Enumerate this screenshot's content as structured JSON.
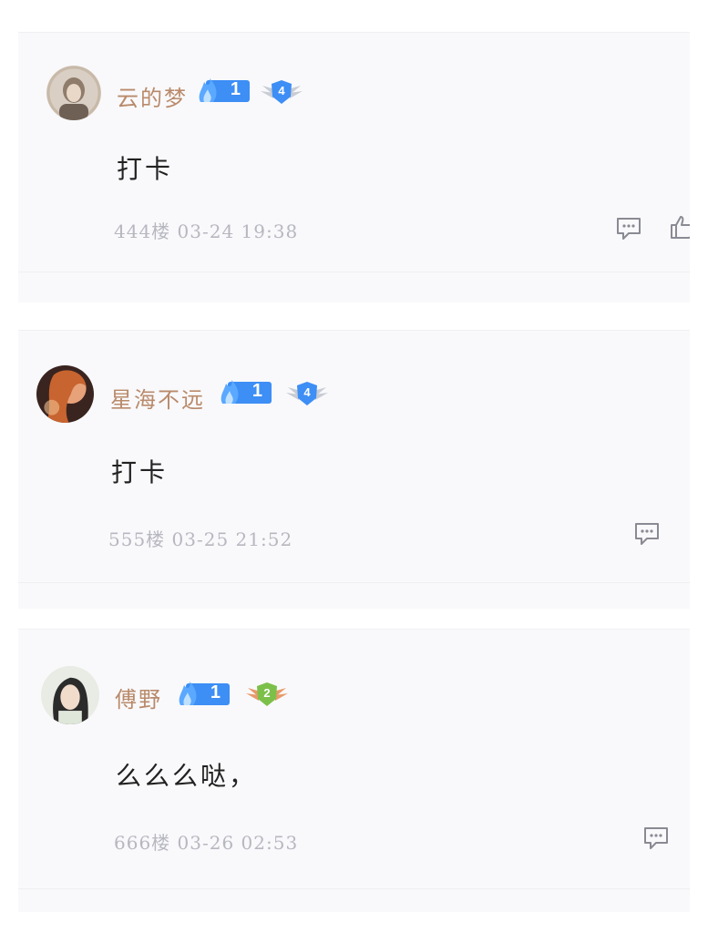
{
  "colors": {
    "username": "#b98a6b",
    "fire_badge": "#3d8ef5",
    "rank_badge_blue": "#3d8ef5",
    "rank_badge_green": "#7cc04a",
    "meta_text": "#b7b7c0",
    "card_bg": "#f9f9fb"
  },
  "comments": [
    {
      "username": "云的梦",
      "fire_level": "1",
      "rank_level": "4",
      "rank_color": "blue",
      "content": "打卡",
      "floor_time": "444楼 03-24 19:38",
      "icons": [
        "comment-icon",
        "thumbs-up-icon"
      ]
    },
    {
      "username": "星海不远",
      "fire_level": "1",
      "rank_level": "4",
      "rank_color": "blue",
      "content": "打卡",
      "floor_time": "555楼 03-25 21:52",
      "icons": [
        "comment-icon"
      ]
    },
    {
      "username": "傅野",
      "fire_level": "1",
      "rank_level": "2",
      "rank_color": "green",
      "content": "么么么哒，",
      "floor_time": "666楼 03-26 02:53",
      "icons": [
        "comment-icon"
      ]
    }
  ]
}
